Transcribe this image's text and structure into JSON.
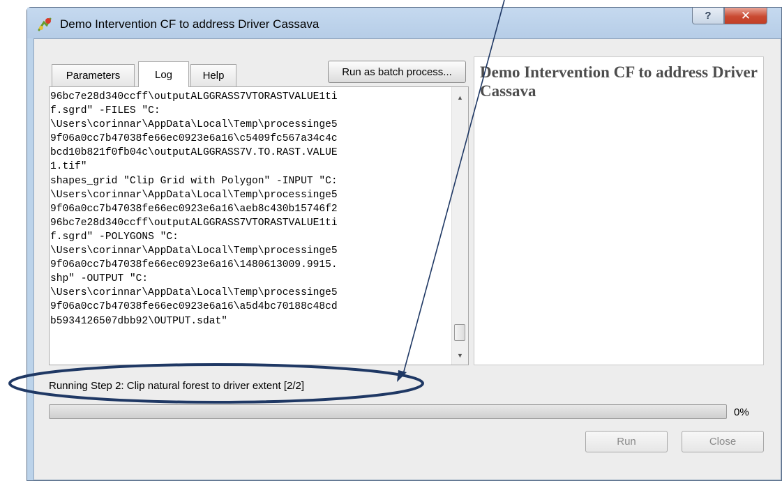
{
  "window": {
    "title": "Demo Intervention CF to address Driver Cassava",
    "help_glyph": "?",
    "close_glyph": "✕"
  },
  "tabs": [
    {
      "label": "Parameters",
      "active": false
    },
    {
      "label": "Log",
      "active": true
    },
    {
      "label": "Help",
      "active": false
    }
  ],
  "batch_button": "Run as batch process...",
  "log_lines": [
    "96bc7e28d340ccff\\outputALGGRASS7VTORASTVALUE1ti",
    "f.sgrd\" -FILES \"C:",
    "\\Users\\corinnar\\AppData\\Local\\Temp\\processinge5",
    "9f06a0cc7b47038fe66ec0923e6a16\\c5409fc567a34c4c",
    "bcd10b821f0fb04c\\outputALGGRASS7V.TO.RAST.VALUE",
    "1.tif\"",
    "shapes_grid \"Clip Grid with Polygon\" -INPUT \"C:",
    "\\Users\\corinnar\\AppData\\Local\\Temp\\processinge5",
    "9f06a0cc7b47038fe66ec0923e6a16\\aeb8c430b15746f2",
    "96bc7e28d340ccff\\outputALGGRASS7VTORASTVALUE1ti",
    "f.sgrd\" -POLYGONS \"C:",
    "\\Users\\corinnar\\AppData\\Local\\Temp\\processinge5",
    "9f06a0cc7b47038fe66ec0923e6a16\\1480613009.9915.",
    "shp\" -OUTPUT \"C:",
    "\\Users\\corinnar\\AppData\\Local\\Temp\\processinge5",
    "9f06a0cc7b47038fe66ec0923e6a16\\a5d4bc70188c48cd",
    "b5934126507dbb92\\OUTPUT.sdat\""
  ],
  "description_title": "Demo Intervention CF to address Driver Cassava",
  "status": "Running Step 2: Clip natural forest to driver extent [2/2]",
  "progress": {
    "value": 0,
    "label": "0%"
  },
  "buttons": {
    "run": "Run",
    "close": "Close"
  },
  "colors": {
    "annotation": "#1f3864",
    "accent": "#3bb33b"
  }
}
